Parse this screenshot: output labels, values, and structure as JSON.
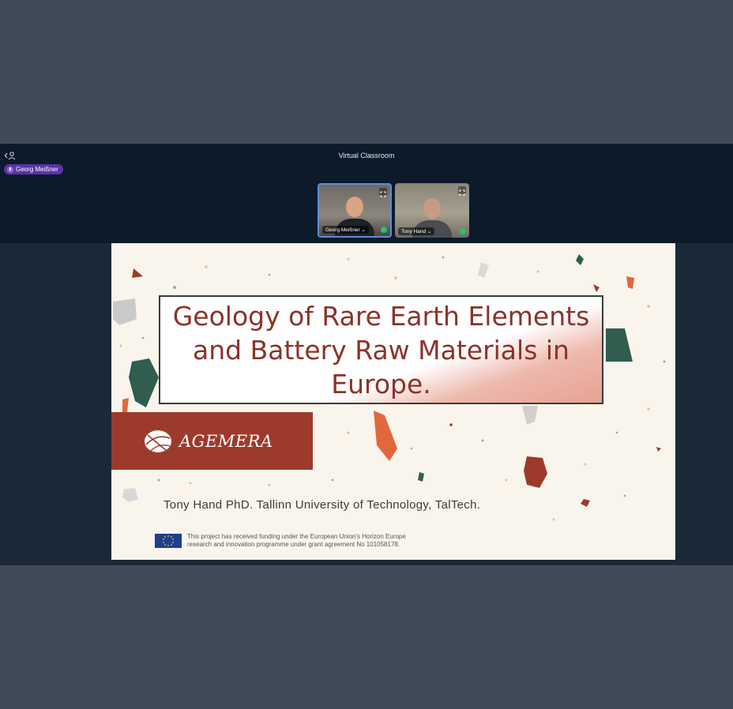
{
  "window": {
    "title": "Virtual Classroom"
  },
  "speaker": {
    "name": "Georg Meißner"
  },
  "participants": [
    {
      "label": "Georg Meißner ⌄",
      "active": true
    },
    {
      "label": "Tony Hand ⌄",
      "active": false
    }
  ],
  "slide": {
    "title": "Geology of Rare Earth Elements and Battery Raw Materials in Europe.",
    "brand": "AGEMERA",
    "presenter": "Tony Hand PhD. Tallinn University of Technology, TalTech.",
    "funding_line1": "This project has received funding under the European Union's Horizon Europe",
    "funding_line2": "research and innovation programme under grant agreement No 101058178."
  },
  "colors": {
    "page_bg": "#414b57",
    "app_bg": "#0f1b2b",
    "accent": "#5a33a8",
    "slide_title": "#8b3328",
    "brand_band": "#9c3b2b"
  }
}
